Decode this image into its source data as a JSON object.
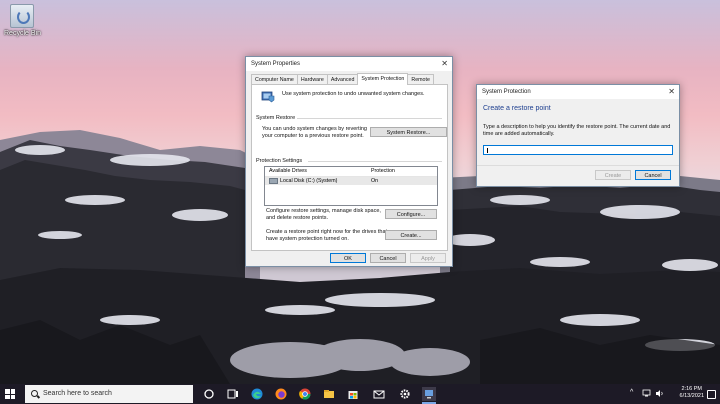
{
  "desktop": {
    "icons": [
      {
        "label": "Recycle Bin",
        "icon": "recycle-bin-icon"
      }
    ]
  },
  "system_properties": {
    "title": "System Properties",
    "tabs": [
      "Computer Name",
      "Hardware",
      "Advanced",
      "System Protection",
      "Remote"
    ],
    "active_tab": "System Protection",
    "intro": "Use system protection to undo unwanted system changes.",
    "system_restore": {
      "label": "System Restore",
      "description_line1": "You can undo system changes by reverting",
      "description_line2": "your computer to a previous restore point.",
      "button": "System Restore..."
    },
    "protection_settings": {
      "label": "Protection Settings",
      "columns": [
        "Available Drives",
        "Protection"
      ],
      "rows": [
        {
          "drive": "Local Disk (C:) (System)",
          "protection": "On"
        }
      ],
      "configure_text_line1": "Configure restore settings, manage disk space,",
      "configure_text_line2": "and delete restore points.",
      "configure_button": "Configure...",
      "create_text_line1": "Create a restore point right now for the drives that",
      "create_text_line2": "have system protection turned on.",
      "create_button": "Create..."
    },
    "footer": {
      "ok": "OK",
      "cancel": "Cancel",
      "apply": "Apply"
    }
  },
  "restore_dialog": {
    "title": "System Protection",
    "heading": "Create a restore point",
    "description_line1": "Type a description to help you identify the restore point. The current date and",
    "description_line2": "time are added automatically.",
    "input_value": "",
    "create_button": "Create",
    "cancel_button": "Cancel"
  },
  "taskbar": {
    "search_placeholder": "Search here to search",
    "pinned": [
      "task-view-icon",
      "edge-icon",
      "firefox-icon",
      "chrome-icon",
      "file-explorer-icon",
      "store-icon",
      "mail-icon",
      "settings-icon",
      "system-properties-icon"
    ],
    "time": "2:16 PM",
    "date": "6/13/2021"
  }
}
